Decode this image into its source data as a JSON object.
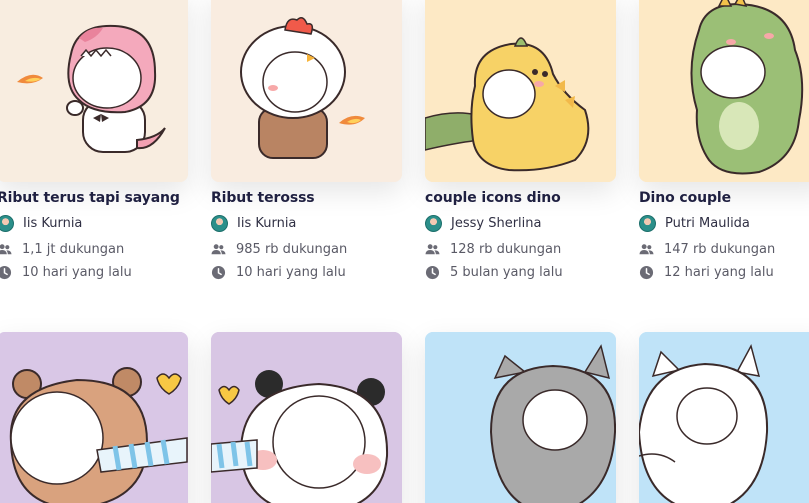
{
  "cards": [
    {
      "title": "Ribut terus tapi sayang",
      "creator": "Iis Kurnia",
      "supporters": "1,1 jt dukungan",
      "time": "10 hari yang lalu",
      "bg": "#f8ede0"
    },
    {
      "title": "Ribut terosss",
      "creator": "Iis Kurnia",
      "supporters": "985 rb dukungan",
      "time": "10 hari yang lalu",
      "bg": "#f9ece0"
    },
    {
      "title": "couple icons dino",
      "creator": "Jessy Sherlina",
      "supporters": "128 rb dukungan",
      "time": "5 bulan yang lalu",
      "bg": "#fde9c5"
    },
    {
      "title": "Dino couple",
      "creator": "Putri Maulida",
      "supporters": "147 rb dukungan",
      "time": "12 hari yang lalu",
      "bg": "#fde9c5"
    }
  ],
  "row2": [
    {
      "bg": "#d9c7e6"
    },
    {
      "bg": "#d8c6e4"
    },
    {
      "bg": "#bfe3f8"
    },
    {
      "bg": "#bfe3f8"
    }
  ],
  "icons": {
    "supporters": "people-icon",
    "time": "clock-icon",
    "creator": "avatar"
  }
}
